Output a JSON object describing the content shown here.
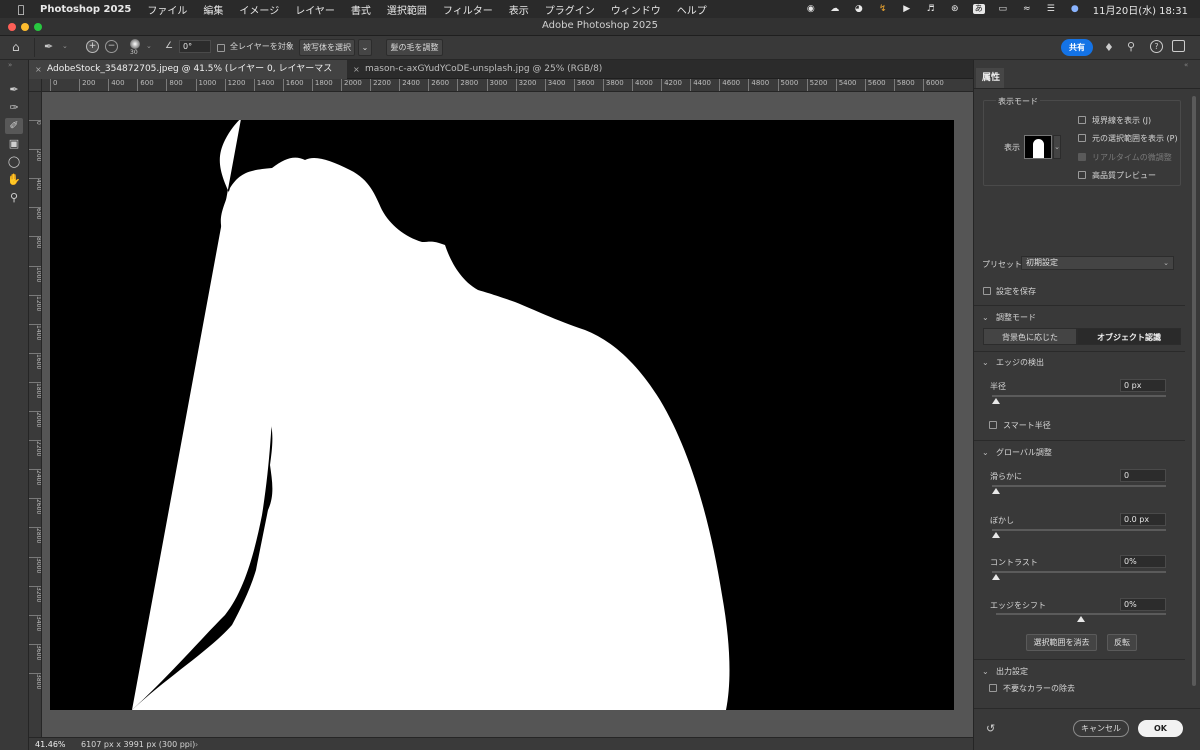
{
  "menubar": {
    "app_name": "Photoshop 2025",
    "menus": [
      "ファイル",
      "編集",
      "イメージ",
      "レイヤー",
      "書式",
      "選択範囲",
      "フィルター",
      "表示",
      "プラグイン",
      "ウィンドウ",
      "ヘルプ"
    ],
    "input_method": "あ",
    "clock": "11月20日(水)  18:31"
  },
  "window": {
    "title": "Adobe Photoshop 2025"
  },
  "options": {
    "brush_size": "30",
    "angle_value": "0°",
    "sample_all_layers_label": "全レイヤーを対象",
    "select_subject_label": "被写体を選択",
    "refine_hair_label": "髪の毛を調整",
    "share_label": "共有"
  },
  "tabs": [
    {
      "label": "AdobeStock_354872705.jpeg @ 41.5% (レイヤー 0, レイヤーマスク/8) *",
      "close": "×",
      "active": true
    },
    {
      "label": "mason-c-axGYudYCoDE-unsplash.jpg @ 25% (RGB/8)",
      "close": "×",
      "active": false
    }
  ],
  "ruler": {
    "top_ticks": [
      "0",
      "200",
      "400",
      "600",
      "800",
      "1000",
      "1200",
      "1400",
      "1600",
      "1800",
      "2000",
      "2200",
      "2400",
      "2600",
      "2800",
      "3000",
      "3200",
      "3400",
      "3600",
      "3800",
      "4000",
      "4200",
      "4400",
      "4600",
      "4800",
      "5000",
      "5200",
      "5400",
      "5600",
      "5800",
      "6000"
    ],
    "left_ticks": [
      "0",
      "200",
      "400",
      "600",
      "800",
      "1000",
      "1200",
      "1400",
      "1600",
      "1800",
      "2000",
      "2200",
      "2400",
      "2600",
      "2800",
      "3000",
      "3200",
      "3400",
      "3600",
      "3800"
    ]
  },
  "status": {
    "zoom": "41.46%",
    "doc_info": "6107 px x 3991 px (300 ppi)",
    "arrow": "›"
  },
  "panel": {
    "tab_label": "属性",
    "view_mode": {
      "group_label": "表示モード",
      "view_label": "表示",
      "show_edge": "境界線を表示 (J)",
      "show_original": "元の選択範囲を表示 (P)",
      "realtime_refine": "リアルタイムの微調整",
      "high_quality_preview": "高品質プレビュー"
    },
    "preset_label": "プリセット",
    "preset_value": "初期設定",
    "save_settings": "設定を保存",
    "refine_mode": {
      "title": "調整モード",
      "color_aware": "背景色に応じた",
      "object_aware": "オブジェクト認識"
    },
    "edge_detection": {
      "title": "エッジの検出",
      "radius_label": "半径",
      "radius_value": "0 px",
      "smart_radius": "スマート半径"
    },
    "global_refinements": {
      "title": "グローバル調整",
      "smooth_label": "滑らかに",
      "smooth_value": "0",
      "feather_label": "ぼかし",
      "feather_value": "0.0 px",
      "contrast_label": "コントラスト",
      "contrast_value": "0%",
      "shift_edge_label": "エッジをシフト",
      "shift_edge_value": "0%",
      "clear_selection": "選択範囲を消去",
      "invert": "反転"
    },
    "output": {
      "title": "出力設定",
      "decontaminate": "不要なカラーの除去"
    },
    "cancel_label": "キャンセル",
    "ok_label": "OK"
  }
}
